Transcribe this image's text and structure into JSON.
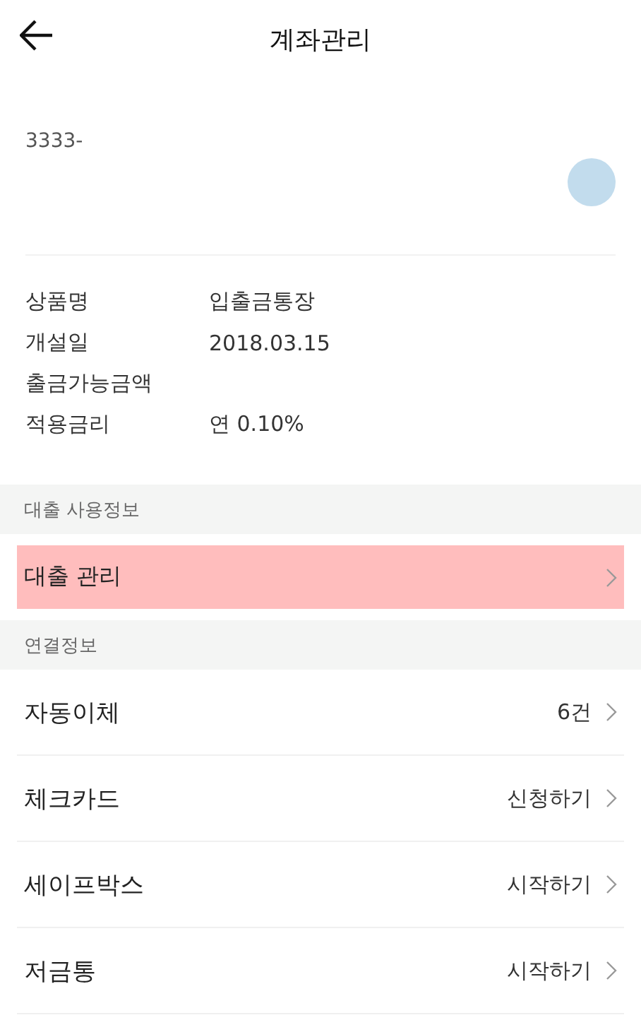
{
  "header": {
    "title": "계좌관리"
  },
  "account": {
    "number": "3333-"
  },
  "details": [
    {
      "label": "상품명",
      "value": "입출금통장"
    },
    {
      "label": "개설일",
      "value": "2018.03.15"
    },
    {
      "label": "출금가능금액"
    },
    {
      "label": "적용금리",
      "value": "연 0.10%"
    }
  ],
  "sections": [
    {
      "title": "대출 사용정보",
      "items": [
        {
          "label": "대출 관리",
          "highlighted": true
        }
      ]
    },
    {
      "title": "연결정보",
      "items": [
        {
          "label": "자동이체",
          "value": "6건",
          "highlighted": false
        },
        {
          "label": "체크카드",
          "value": "신청하기",
          "highlighted": false
        },
        {
          "label": "세이프박스",
          "value": "시작하기",
          "highlighted": false
        },
        {
          "label": "저금통",
          "value": "시작하기",
          "highlighted": false
        }
      ]
    }
  ]
}
